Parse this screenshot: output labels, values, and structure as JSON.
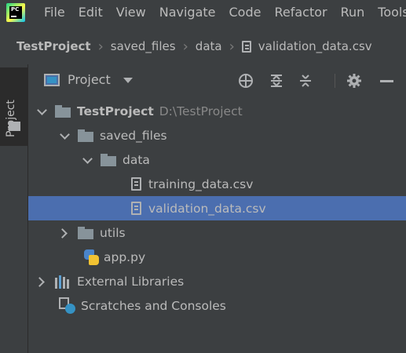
{
  "menubar": {
    "logo_text": "PC",
    "items": [
      "File",
      "Edit",
      "View",
      "Navigate",
      "Code",
      "Refactor",
      "Run",
      "Tools"
    ]
  },
  "breadcrumb": {
    "items": [
      "TestProject",
      "saved_files",
      "data",
      "validation_data.csv"
    ]
  },
  "stripe": {
    "project_label": "Project"
  },
  "toolwindow": {
    "title": "Project",
    "buttons": [
      "locate-icon",
      "expand-all-icon",
      "collapse-all-icon",
      "gear-icon",
      "hide-icon"
    ]
  },
  "tree": {
    "root": {
      "name": "TestProject",
      "path": "D:\\TestProject"
    },
    "saved_files": "saved_files",
    "data": "data",
    "training": "training_data.csv",
    "validation": "validation_data.csv",
    "utils": "utils",
    "app": "app.py",
    "external": "External Libraries",
    "scratches": "Scratches and Consoles"
  },
  "colors": {
    "background": "#3c3f41",
    "selection": "#4b6eaf",
    "text": "#bbbbbb"
  }
}
